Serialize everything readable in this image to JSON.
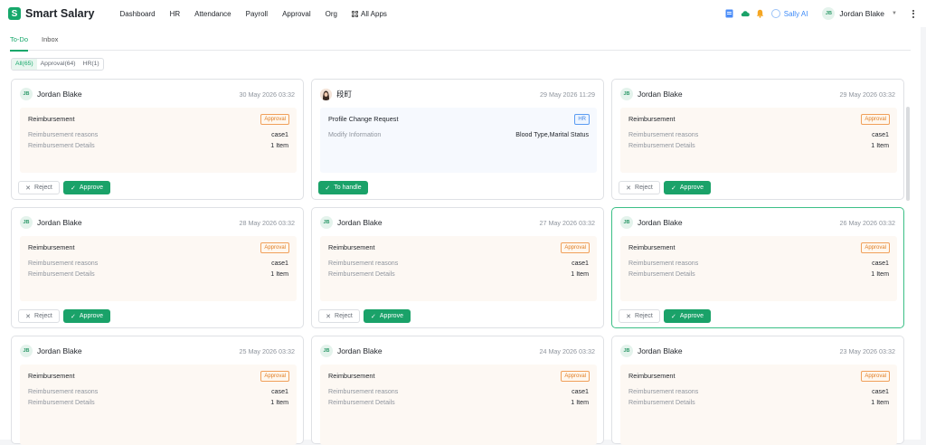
{
  "app": {
    "name": "Smart Salary",
    "logo_letter": "S"
  },
  "nav": {
    "items": [
      "Dashboard",
      "HR",
      "Attendance",
      "Payroll",
      "Approval",
      "Org",
      "All Apps"
    ]
  },
  "topbar": {
    "assistant": "Sally AI",
    "user_name": "Jordan Blake",
    "user_initials": "JB"
  },
  "tabs": [
    "To-Do",
    "Inbox"
  ],
  "filters": [
    "All(65)",
    "Approval(64)",
    "HR(1)"
  ],
  "buttons": {
    "reject": "Reject",
    "approve": "Approve",
    "to_handle": "To handle"
  },
  "colors": {
    "brand": "#1aa269",
    "approval_tag": "#e07e25",
    "hr_tag": "#3d84e6"
  },
  "cards": [
    {
      "initials": "JB",
      "name": "Jordan Blake",
      "date": "30 May 2026 03:32",
      "title": "Reimbursement",
      "tag": "Approval",
      "rows": [
        [
          "Reimbursement reasons",
          "case1"
        ],
        [
          "Reimbursement Details",
          "1 Item"
        ]
      ]
    },
    {
      "initials": "",
      "name": "段町",
      "date": "29 May 2026 11:29",
      "title": "Profile Change Request",
      "tag": "HR",
      "rows": [
        [
          "Modify Information",
          "Blood Type,Marital Status"
        ]
      ]
    },
    {
      "initials": "JB",
      "name": "Jordan Blake",
      "date": "29 May 2026 03:32",
      "title": "Reimbursement",
      "tag": "Approval",
      "rows": [
        [
          "Reimbursement reasons",
          "case1"
        ],
        [
          "Reimbursement Details",
          "1 Item"
        ]
      ]
    },
    {
      "initials": "JB",
      "name": "Jordan Blake",
      "date": "28 May 2026 03:32",
      "title": "Reimbursement",
      "tag": "Approval",
      "rows": [
        [
          "Reimbursement reasons",
          "case1"
        ],
        [
          "Reimbursement Details",
          "1 Item"
        ]
      ]
    },
    {
      "initials": "JB",
      "name": "Jordan Blake",
      "date": "27 May 2026 03:32",
      "title": "Reimbursement",
      "tag": "Approval",
      "rows": [
        [
          "Reimbursement reasons",
          "case1"
        ],
        [
          "Reimbursement Details",
          "1 Item"
        ]
      ]
    },
    {
      "initials": "JB",
      "name": "Jordan Blake",
      "date": "26 May 2026 03:32",
      "title": "Reimbursement",
      "tag": "Approval",
      "rows": [
        [
          "Reimbursement reasons",
          "case1"
        ],
        [
          "Reimbursement Details",
          "1 Item"
        ]
      ]
    },
    {
      "initials": "JB",
      "name": "Jordan Blake",
      "date": "25 May 2026 03:32",
      "title": "Reimbursement",
      "tag": "Approval",
      "rows": [
        [
          "Reimbursement reasons",
          "case1"
        ],
        [
          "Reimbursement Details",
          "1 Item"
        ]
      ]
    },
    {
      "initials": "JB",
      "name": "Jordan Blake",
      "date": "24 May 2026 03:32",
      "title": "Reimbursement",
      "tag": "Approval",
      "rows": [
        [
          "Reimbursement reasons",
          "case1"
        ],
        [
          "Reimbursement Details",
          "1 Item"
        ]
      ]
    },
    {
      "initials": "JB",
      "name": "Jordan Blake",
      "date": "23 May 2026 03:32",
      "title": "Reimbursement",
      "tag": "Approval",
      "rows": [
        [
          "Reimbursement reasons",
          "case1"
        ],
        [
          "Reimbursement Details",
          "1 Item"
        ]
      ]
    }
  ]
}
